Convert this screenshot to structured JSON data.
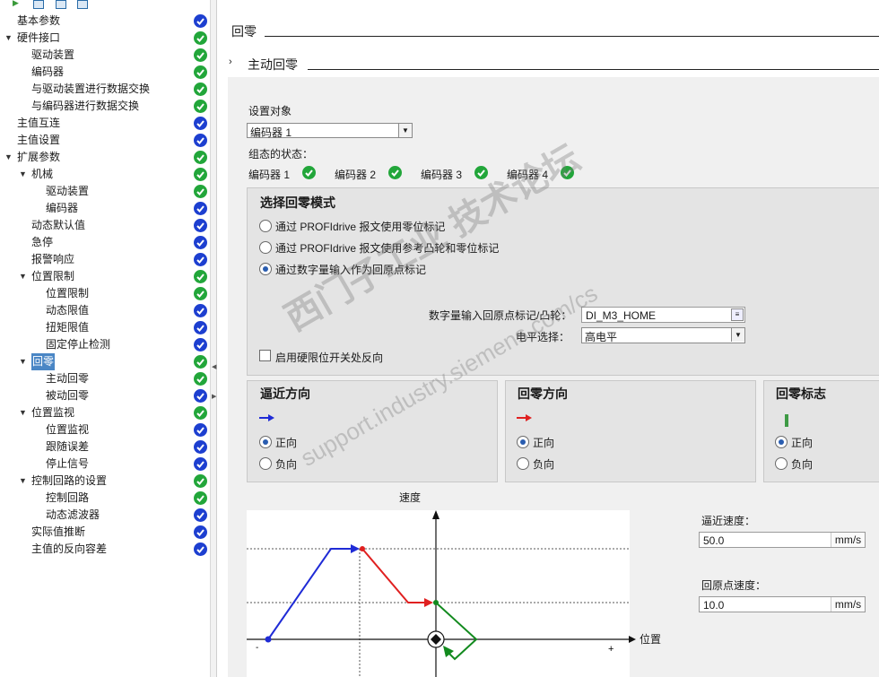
{
  "tree": [
    {
      "label": "基本参数",
      "level": 0,
      "expand": "",
      "status": "blue"
    },
    {
      "label": "硬件接口",
      "level": 0,
      "expand": "open",
      "status": "green"
    },
    {
      "label": "驱动装置",
      "level": 1,
      "expand": "",
      "status": "green"
    },
    {
      "label": "编码器",
      "level": 1,
      "expand": "",
      "status": "green"
    },
    {
      "label": "与驱动装置进行数据交换",
      "level": 1,
      "expand": "",
      "status": "green"
    },
    {
      "label": "与编码器进行数据交换",
      "level": 1,
      "expand": "",
      "status": "green"
    },
    {
      "label": "主值互连",
      "level": 0,
      "expand": "",
      "status": "blue"
    },
    {
      "label": "主值设置",
      "level": 0,
      "expand": "",
      "status": "blue"
    },
    {
      "label": "扩展参数",
      "level": 0,
      "expand": "open",
      "status": "green"
    },
    {
      "label": "机械",
      "level": 1,
      "expand": "open",
      "status": "green"
    },
    {
      "label": "驱动装置",
      "level": 2,
      "expand": "",
      "status": "green"
    },
    {
      "label": "编码器",
      "level": 2,
      "expand": "",
      "status": "blue"
    },
    {
      "label": "动态默认值",
      "level": 1,
      "expand": "",
      "status": "blue"
    },
    {
      "label": "急停",
      "level": 1,
      "expand": "",
      "status": "blue"
    },
    {
      "label": "报警响应",
      "level": 1,
      "expand": "",
      "status": "blue"
    },
    {
      "label": "位置限制",
      "level": 1,
      "expand": "open",
      "status": "green"
    },
    {
      "label": "位置限制",
      "level": 2,
      "expand": "",
      "status": "green"
    },
    {
      "label": "动态限值",
      "level": 2,
      "expand": "",
      "status": "blue"
    },
    {
      "label": "扭矩限值",
      "level": 2,
      "expand": "",
      "status": "blue"
    },
    {
      "label": "固定停止检测",
      "level": 2,
      "expand": "",
      "status": "blue"
    },
    {
      "label": "回零",
      "level": 1,
      "expand": "open",
      "status": "green",
      "selected": true
    },
    {
      "label": "主动回零",
      "level": 2,
      "expand": "",
      "status": "green"
    },
    {
      "label": "被动回零",
      "level": 2,
      "expand": "",
      "status": "blue"
    },
    {
      "label": "位置监视",
      "level": 1,
      "expand": "open",
      "status": "green"
    },
    {
      "label": "位置监视",
      "level": 2,
      "expand": "",
      "status": "blue"
    },
    {
      "label": "跟随误差",
      "level": 2,
      "expand": "",
      "status": "blue"
    },
    {
      "label": "停止信号",
      "level": 2,
      "expand": "",
      "status": "blue"
    },
    {
      "label": "控制回路的设置",
      "level": 1,
      "expand": "open",
      "status": "green"
    },
    {
      "label": "控制回路",
      "level": 2,
      "expand": "",
      "status": "green"
    },
    {
      "label": "动态滤波器",
      "level": 2,
      "expand": "",
      "status": "blue"
    },
    {
      "label": "实际值推断",
      "level": 1,
      "expand": "",
      "status": "blue"
    },
    {
      "label": "主值的反向容差",
      "level": 1,
      "expand": "",
      "status": "blue"
    }
  ],
  "section_title": "回零",
  "subsection_title": "主动回零",
  "set_object_label": "设置对象",
  "set_object_value": "编码器 1",
  "config_status_label": "组态的状态：",
  "encoders": [
    "编码器 1",
    "编码器 2",
    "编码器 3",
    "编码器 4"
  ],
  "mode_title": "选择回零模式",
  "modes": [
    {
      "label": "通过 PROFIdrive 报文使用零位标记",
      "selected": false
    },
    {
      "label": "通过 PROFIdrive 报文使用参考凸轮和零位标记",
      "selected": false
    },
    {
      "label": "通过数字量输入作为回原点标记",
      "selected": true
    }
  ],
  "digital_input_label": "数字量输入回原点标记/凸轮：",
  "digital_input_value": "DI_M3_HOME",
  "level_label": "电平选择：",
  "level_value": "高电平",
  "reverse_checkbox_label": "启用硬限位开关处反向",
  "approach_dir": {
    "title": "逼近方向",
    "pos": "正向",
    "neg": "负向",
    "arrow_color": "#1f2bd6"
  },
  "home_dir": {
    "title": "回零方向",
    "pos": "正向",
    "neg": "负向",
    "arrow_color": "#e02020"
  },
  "home_mark": {
    "title": "回零标志",
    "pos": "正向",
    "neg": "负向",
    "bar_color": "#3e9a45"
  },
  "chart_y_label": "速度",
  "chart_x_label": "位置",
  "axis_minus": "-",
  "axis_plus": "+",
  "approach_speed_label": "逼近速度：",
  "approach_speed_value": "50.0",
  "approach_speed_unit": "mm/s",
  "home_speed_label": "回原点速度：",
  "home_speed_value": "10.0",
  "home_speed_unit": "mm/s",
  "watermark_1": "西门子工业 技术论坛",
  "watermark_2": "support.industry.siemens.com/cs"
}
